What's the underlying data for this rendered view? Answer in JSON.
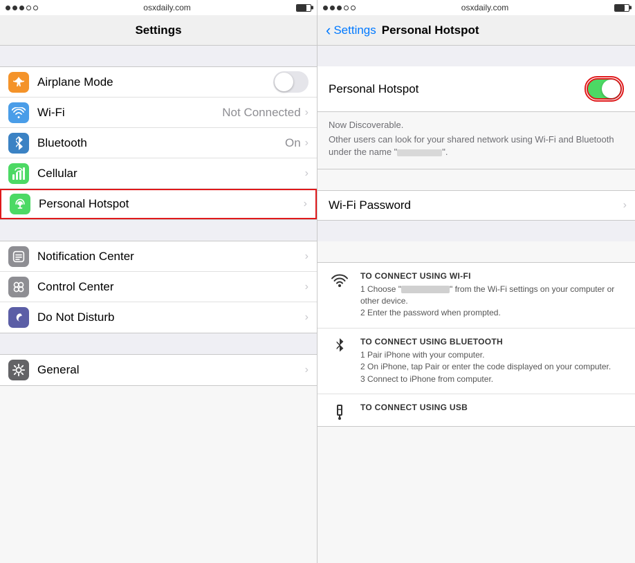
{
  "left": {
    "status_bar": {
      "url": "osxdaily.com",
      "battery_level": "70"
    },
    "nav": {
      "title": "Settings"
    },
    "rows": [
      {
        "id": "airplane-mode",
        "label": "Airplane Mode",
        "icon_class": "icon-orange",
        "icon": "airplane",
        "has_toggle": true,
        "toggle_on": false,
        "has_chevron": false,
        "value": "",
        "highlighted": false
      },
      {
        "id": "wifi",
        "label": "Wi-Fi",
        "icon_class": "icon-blue",
        "icon": "wifi",
        "has_toggle": false,
        "has_chevron": true,
        "value": "Not Connected",
        "highlighted": false
      },
      {
        "id": "bluetooth",
        "label": "Bluetooth",
        "icon_class": "icon-blue2",
        "icon": "bluetooth",
        "has_toggle": false,
        "has_chevron": true,
        "value": "On",
        "highlighted": false
      },
      {
        "id": "cellular",
        "label": "Cellular",
        "icon_class": "icon-green",
        "icon": "cellular",
        "has_toggle": false,
        "has_chevron": true,
        "value": "",
        "highlighted": false
      },
      {
        "id": "personal-hotspot",
        "label": "Personal Hotspot",
        "icon_class": "icon-green",
        "icon": "hotspot",
        "has_toggle": false,
        "has_chevron": true,
        "value": "",
        "highlighted": true
      }
    ],
    "rows2": [
      {
        "id": "notification-center",
        "label": "Notification Center",
        "icon_class": "icon-gray",
        "icon": "notification",
        "has_chevron": true
      },
      {
        "id": "control-center",
        "label": "Control Center",
        "icon_class": "icon-gray",
        "icon": "control",
        "has_chevron": true
      },
      {
        "id": "do-not-disturb",
        "label": "Do Not Disturb",
        "icon_class": "icon-purple",
        "icon": "moon",
        "has_chevron": true
      }
    ],
    "rows3": [
      {
        "id": "general",
        "label": "General",
        "icon_class": "icon-darkgray",
        "icon": "gear",
        "has_chevron": true
      }
    ]
  },
  "right": {
    "status_bar": {
      "url": "osxdaily.com"
    },
    "nav": {
      "back_label": "Settings",
      "title": "Personal Hotspot"
    },
    "hotspot": {
      "label": "Personal Hotspot",
      "enabled": true
    },
    "discoverable": {
      "line1": "Now Discoverable.",
      "line2": "Other users can look for your shared network using Wi-Fi and Bluetooth under the name “",
      "line3": "”."
    },
    "wifi_password": {
      "label": "Wi-Fi Password"
    },
    "instructions": [
      {
        "icon": "wifi",
        "title": "TO CONNECT USING WI-FI",
        "steps": [
          "1 Choose “",
          "” from the Wi-Fi settings on your computer or other device.",
          "2 Enter the password when prompted."
        ],
        "has_blank": true,
        "blank_after": 0
      },
      {
        "icon": "bluetooth",
        "title": "TO CONNECT USING BLUETOOTH",
        "steps": [
          "1 Pair iPhone with your computer.",
          "2 On iPhone, tap Pair or enter the code displayed on your computer.",
          "3 Connect to iPhone from computer."
        ],
        "has_blank": false
      },
      {
        "icon": "usb",
        "title": "TO CONNECT USING USB",
        "steps": [],
        "has_blank": false
      }
    ]
  }
}
